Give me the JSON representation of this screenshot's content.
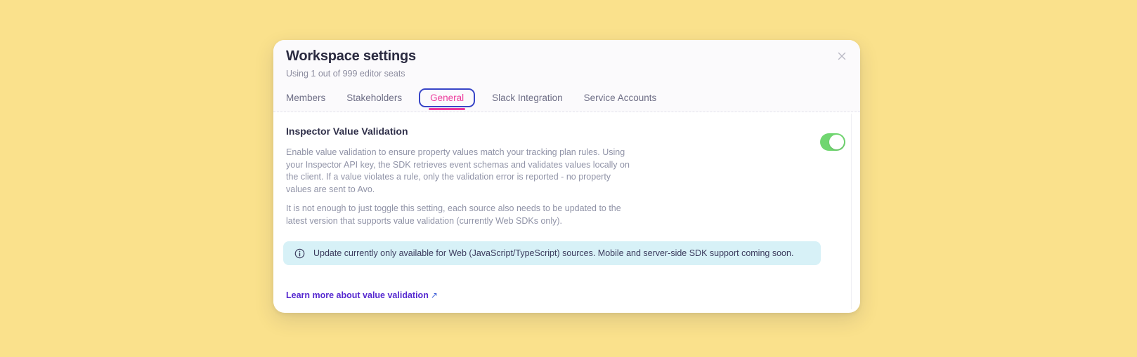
{
  "page": {
    "background_color": "#FAE18C"
  },
  "modal": {
    "title": "Workspace settings",
    "subtitle": "Using 1 out of 999 editor seats",
    "close_icon": "x-close",
    "tabs": [
      {
        "label": "Members",
        "active": false
      },
      {
        "label": "Stakeholders",
        "active": false
      },
      {
        "label": "General",
        "active": true
      },
      {
        "label": "Slack Integration",
        "active": false
      },
      {
        "label": "Service Accounts",
        "active": false
      }
    ],
    "colors": {
      "active_tab_pink": "#EC3C9C",
      "focus_ring_blue": "#3845C7",
      "toggle_green": "#70D670",
      "banner_cyan": "#D7F1F7",
      "link_purple": "#5629D0"
    },
    "section": {
      "heading": "Inspector Value Validation",
      "toggle_state": "on",
      "paragraph1": "Enable value validation to ensure property values match your tracking plan rules. Using your Inspector API key, the SDK retrieves event schemas and validates values locally on the client. If a value violates a rule, only the validation error is reported - no property values are sent to Avo.",
      "paragraph2": "It is not enough to just toggle this setting, each source also needs to be updated to the latest version that supports value validation (currently Web SDKs only).",
      "info_banner": {
        "icon": "info-circle",
        "text": "Update currently only available for Web (JavaScript/TypeScript) sources. Mobile and server-side SDK support coming soon."
      },
      "link": {
        "label": "Learn more about value validation",
        "arrow": "↗"
      }
    }
  }
}
